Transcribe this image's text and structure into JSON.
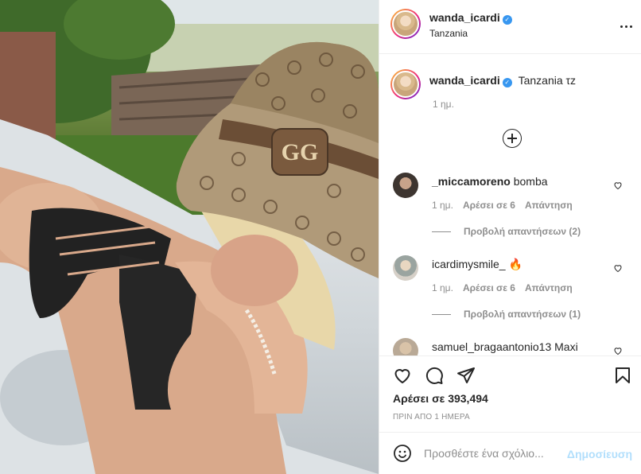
{
  "post": {
    "username": "wanda_icardi",
    "location": "Tanzania",
    "caption_text": "Tanzania τz",
    "caption_time": "1 ημ.",
    "likes_text": "Αρέσει σε 393,494",
    "posted_text": "ΠΡΙΝ ΑΠΟ 1 ΗΜΕΡΑ"
  },
  "comments": [
    {
      "username": "_miccamoreno",
      "text": "bomba",
      "time": "1 ημ.",
      "likes": "Αρέσει σε 6",
      "reply_label": "Απάντηση",
      "view_replies": "Προβολή απαντήσεων (2)"
    },
    {
      "username": "icardimysmile_",
      "text": "🔥",
      "time": "1 ημ.",
      "likes": "Αρέσει σε 6",
      "reply_label": "Απάντηση",
      "view_replies": "Προβολή απαντήσεων (1)"
    },
    {
      "username": "samuel_bragaantonio13",
      "text": "Maxi"
    }
  ],
  "add_comment": {
    "placeholder": "Προσθέστε ένα σχόλιο...",
    "post_label": "Δημοσίευση"
  },
  "icons": {
    "header_more": "more-horizontal-icon",
    "load_more": "plus-circle-icon",
    "like": "heart-icon",
    "comment": "comment-bubble-icon",
    "share": "paper-plane-icon",
    "save": "bookmark-icon",
    "emoji": "emoji-smile-icon",
    "verified": "verified-badge-icon"
  },
  "colors": {
    "verified": "#3897f0",
    "text": "#262626",
    "muted": "#8e8e8e",
    "post_button_disabled": "#b2dffc"
  }
}
